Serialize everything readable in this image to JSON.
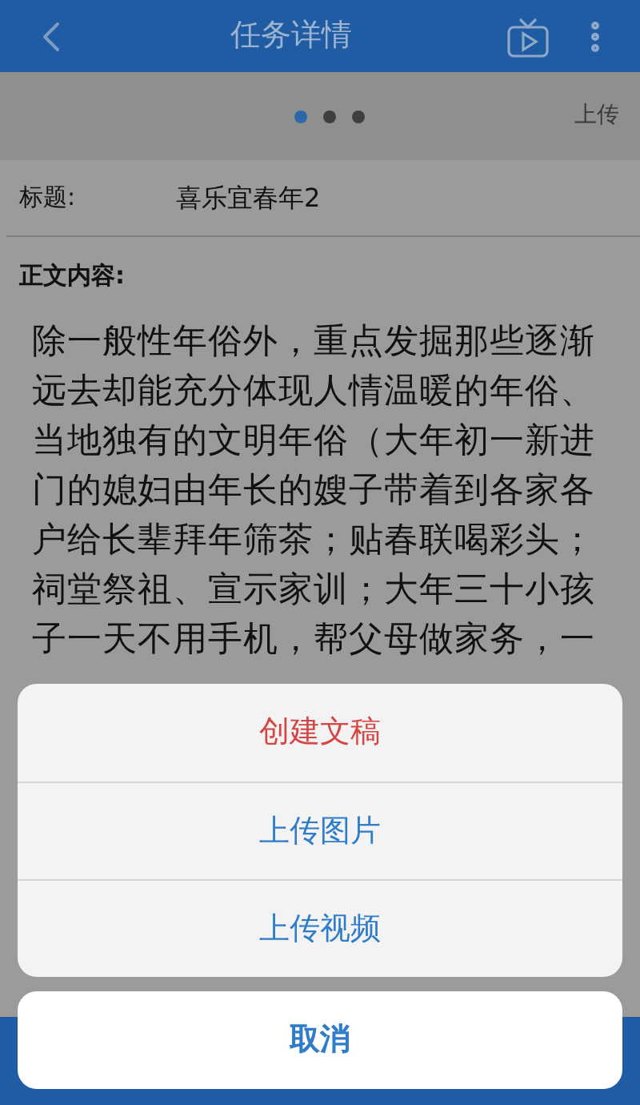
{
  "header": {
    "title": "任务详情"
  },
  "pager": {
    "dots": [
      {
        "selected": true
      },
      {
        "selected": false
      },
      {
        "selected": false
      }
    ],
    "action": "上传"
  },
  "fields": {
    "title_label": "标题:",
    "title_value": "喜乐宜春年2",
    "body_label": "正文内容:",
    "body_text": "除一般性年俗外，重点发掘那些逐渐远去却能充分体现人情温暖的年俗、当地独有的文明年俗（大年初一新进门的媳妇由年长的嫂子带着到各家各户给长辈拜年筛茶；贴春联喝彩头；祠堂祭祖、宣示家训；大年三十小孩子一天不用手机，帮父母做家务，一"
  },
  "action_sheet": {
    "items": [
      {
        "label": "创建文稿",
        "kind": "destructive"
      },
      {
        "label": "上传图片",
        "kind": "default"
      },
      {
        "label": "上传视频",
        "kind": "default"
      }
    ],
    "cancel": "取消"
  }
}
